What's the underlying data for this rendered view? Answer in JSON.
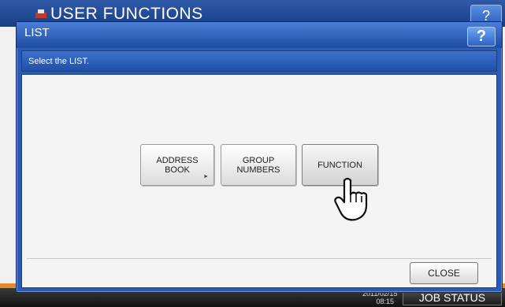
{
  "background": {
    "title": "USER FUNCTIONS",
    "help_label": "?",
    "clock_date": "2011/02/15",
    "clock_time": "08:15",
    "job_status_label": "JOB STATUS"
  },
  "dialog": {
    "title": "LIST",
    "help_label": "?",
    "message": "Select the LIST.",
    "buttons": {
      "address_book_line1": "ADDRESS",
      "address_book_line2": "BOOK",
      "address_book_arrow": "►",
      "group_numbers_line1": "GROUP",
      "group_numbers_line2": "NUMBERS",
      "function": "FUNCTION"
    },
    "close_label": "CLOSE"
  },
  "icons": {
    "logo": "printer-logo-icon",
    "pointer": "hand-pointer-icon"
  },
  "colors": {
    "header_blue": "#2b5bb5",
    "status_orange": "#e88a2a"
  }
}
